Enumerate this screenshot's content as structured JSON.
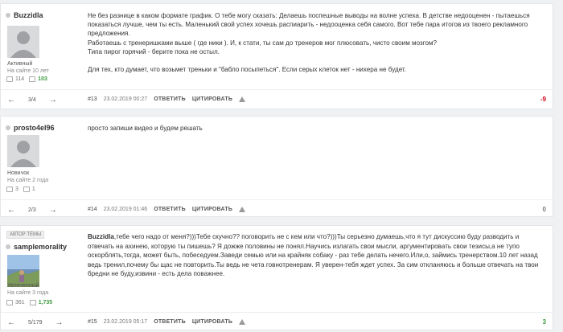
{
  "posts": [
    {
      "username": "Buzzidla",
      "status": "Активный",
      "site_age": "На сайте 10 лет",
      "messages": "114",
      "likes": "103",
      "paragraphs": [
        "Не без разнице в каком формате график. О тебе могу сказать: Делаешь поспешные выводы на волне успеха. В детстве недооценен - пытаешься показаться лучше, чем ты есть. Маленький свой успех хочешь распиарить - недооценка себя самого. Вот тебе пара итогов из твоего рекламного предложения.",
        "Работаешь с тренеришками выше ( где ники ). И, к стати, ты сам до тренеров мог плюсовать, чисто своим мозгом?",
        "Типа пирог горячий - берите пока не остыл.",
        "",
        "Для тех, кто думает, что возьмет треньки и \"бабло посыпеться\". Если серых клеток нет - нихера не будет."
      ],
      "page": "3/4",
      "number": "#13",
      "date": "23.02.2019 00:27",
      "reply": "ОТВЕТИТЬ",
      "quote": "ЦИТИРОВАТЬ",
      "rating": "-9",
      "rating_color": "#d0021b"
    },
    {
      "username": "prosto4el96",
      "status": "Новичок",
      "site_age": "На сайте 2 года",
      "messages": "3",
      "likes": "1",
      "paragraphs": [
        "просто запиши видео и будем решать"
      ],
      "page": "2/3",
      "number": "#14",
      "date": "23.02.2019 01:46",
      "reply": "ОТВЕТИТЬ",
      "quote": "ЦИТИРОВАТЬ",
      "rating": "0",
      "rating_color": "#777777"
    },
    {
      "author_badge": "АВТОР ТЕМЫ",
      "username": "samplemorality",
      "status": "Увлеченный",
      "site_age": "На сайте 3 года",
      "messages": "361",
      "likes": "1,735",
      "lead": "Buzzidla",
      "paragraphs": [
        ",тебе чего надо от меня?)))Тебе скучно?? поговорить не с кем или что?)))Ты серьезно думаешь,что я тут дискуссию буду разводить и отвечать на ахинею, которую ты пишешь? Я дожже половины не понял.Научись излагать свои мысли, аргументировать свои тезисы,а не тупо оскорблять,тогда, может быть, побеседуем.Заведи семью или на крайняк собаку - раз тебе делать нечего.Или,о, займись тренерством.10 лет назад ведь тренил,почему бы щас не повторить.Ты ведь не чета говнотренерам. Я уверен-тебя ждет успех. За сим откланяюсь и больше отвечать на твои бредни не буду,извини - есть дела поважнее."
      ],
      "page": "5/179",
      "number": "#15",
      "date": "23.02.2019 05:17",
      "reply": "ОТВЕТИТЬ",
      "quote": "ЦИТИРОВАТЬ",
      "rating": "3",
      "rating_color": "#3c9a3c"
    }
  ]
}
